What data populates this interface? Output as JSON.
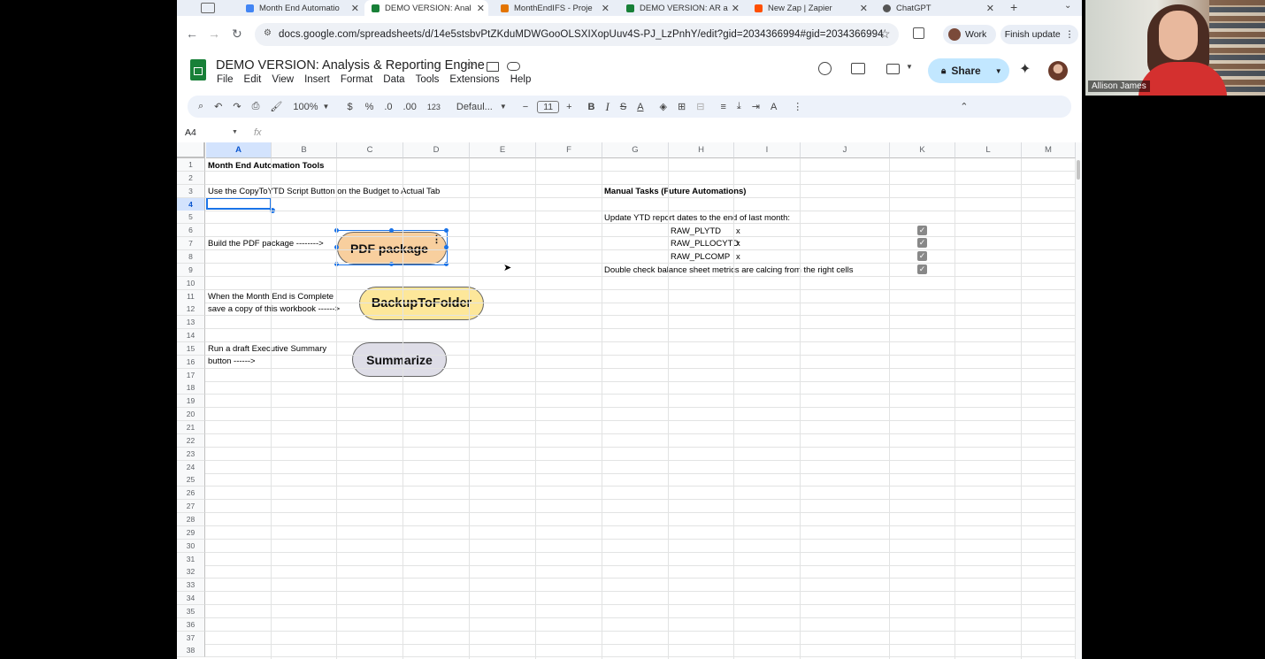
{
  "tabs": [
    {
      "title": "Month End Automatio",
      "active": false
    },
    {
      "title": "DEMO VERSION: Anal",
      "active": true
    },
    {
      "title": "MonthEndIFS - Proje",
      "active": false
    },
    {
      "title": "DEMO VERSION: AR a",
      "active": false
    },
    {
      "title": "New Zap | Zapier",
      "active": false
    },
    {
      "title": "ChatGPT",
      "active": false
    }
  ],
  "browser": {
    "url": "docs.google.com/spreadsheets/d/14e5stsbvPtZKduMDWGooOLSXIXopUuv4S-PJ_LzPnhY/edit?gid=2034366994#gid=2034366994",
    "profile": "Work",
    "update_button": "Finish update"
  },
  "sheet": {
    "title": "DEMO VERSION: Analysis & Reporting Engine",
    "menu": [
      "File",
      "Edit",
      "View",
      "Insert",
      "Format",
      "Data",
      "Tools",
      "Extensions",
      "Help"
    ],
    "share": "Share"
  },
  "toolbar": {
    "zoom": "100%",
    "currency": "$",
    "percent": "%",
    "dec_decrease": ".0",
    "dec_increase": ".00",
    "number_format": "123",
    "font": "Defaul...",
    "font_size": "11"
  },
  "formula_bar": {
    "name_box": "A4",
    "fx": "fx"
  },
  "columns": [
    "A",
    "B",
    "C",
    "D",
    "E",
    "F",
    "G",
    "H",
    "I",
    "J",
    "K",
    "L",
    "M"
  ],
  "rows": [
    "1",
    "2",
    "3",
    "4",
    "5",
    "6",
    "7",
    "8",
    "9",
    "10",
    "11",
    "12",
    "13",
    "14",
    "15",
    "16",
    "17",
    "18",
    "19",
    "20",
    "21",
    "22",
    "23",
    "24",
    "25",
    "26",
    "27",
    "28",
    "29",
    "30",
    "31",
    "32",
    "33",
    "34",
    "35",
    "36",
    "37",
    "38"
  ],
  "cells": {
    "a1": "Month End Automation Tools",
    "a3": "Use the CopyToYTD Script Button on the Budget to Actual Tab",
    "a7": "Build the PDF package  -------->",
    "a11": "When the Month End is Complete",
    "a12": "save a copy of this workbook ------>",
    "a15": "Run a draft Executive Summary",
    "a16": "button ------>",
    "g3": "Manual Tasks (Future Automations)",
    "g5": "Update YTD report dates to the end of last month:",
    "h6": "RAW_PLYTD",
    "h7": "RAW_PLLOCYTD",
    "h8": "RAW_PLCOMP",
    "i6": "x",
    "i7": "x",
    "i8": "x",
    "g9": "Double check balance sheet metrics are calcing from the right cells"
  },
  "checkboxes": [
    {
      "row": "6",
      "checked": true
    },
    {
      "row": "7",
      "checked": true
    },
    {
      "row": "8",
      "checked": true
    },
    {
      "row": "9",
      "checked": true
    }
  ],
  "shapes": {
    "pdf": "PDF package",
    "backup": "BackupToFolder",
    "summarize": "Summarize"
  },
  "webcam": {
    "name": "Allison James"
  },
  "colors": {
    "selection": "#1a73e8",
    "pdf_shape": "#f8cf9e",
    "backup_shape": "#fde79a",
    "summarize_shape": "#dedde7",
    "share_button": "#c2e7ff",
    "sheets_green": "#188038"
  }
}
